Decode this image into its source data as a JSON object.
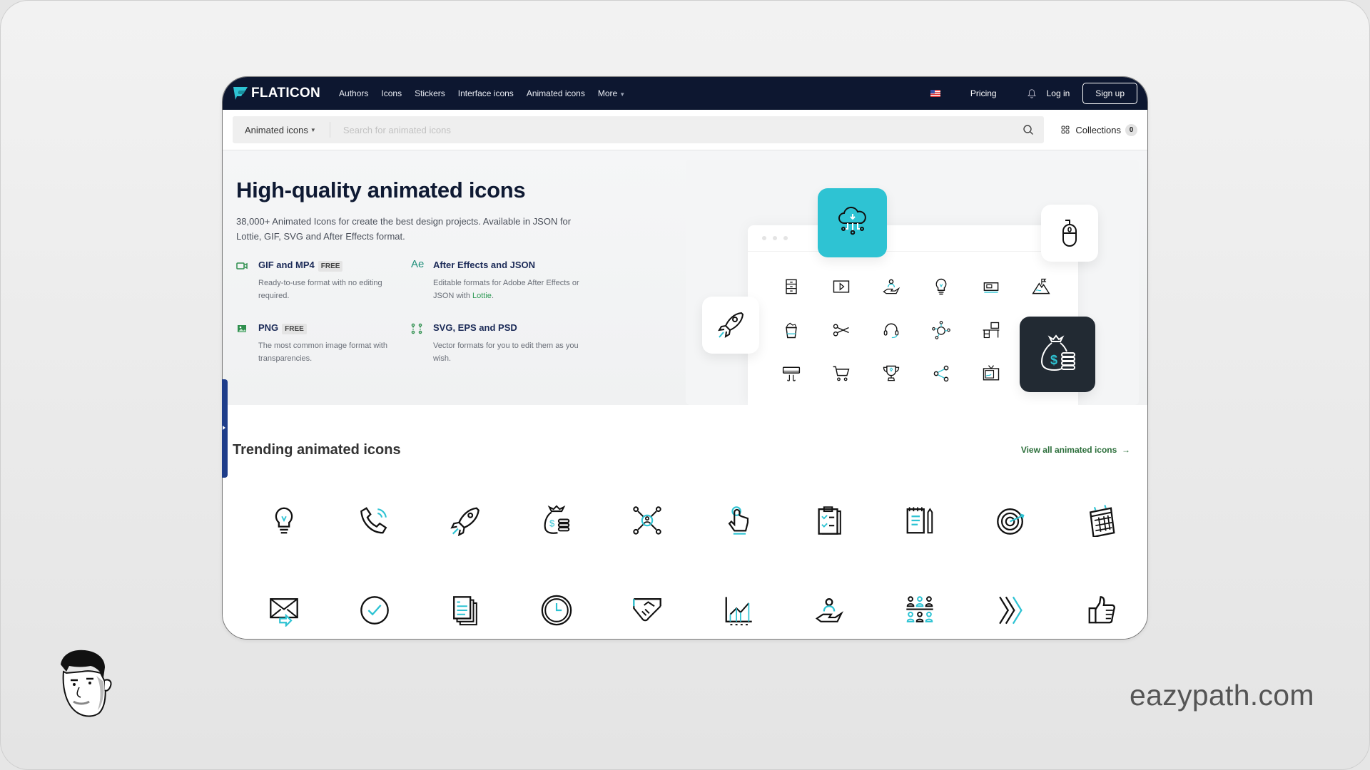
{
  "nav": {
    "logo": "FLATICON",
    "links": [
      "Authors",
      "Icons",
      "Stickers",
      "Interface icons",
      "Animated icons",
      "More"
    ],
    "flag_icon": "us-flag-icon",
    "pricing": "Pricing",
    "login": "Log in",
    "signup": "Sign up"
  },
  "search": {
    "category": "Animated icons",
    "placeholder": "Search for animated icons",
    "value": "",
    "collections_label": "Collections",
    "collections_count": "0"
  },
  "hero": {
    "title": "High-quality animated icons",
    "subtitle": "38,000+ Animated Icons for create the best design projects. Available in JSON for Lottie, GIF, SVG and After Effects format.",
    "features": [
      {
        "icon": "video-icon",
        "title": "GIF and MP4",
        "badge": "FREE",
        "desc": "Ready-to-use format with no editing required."
      },
      {
        "icon": "after-effects-icon",
        "icon_text": "Ae",
        "title": "After Effects and JSON",
        "badge": "",
        "desc_pre": "Editable formats for Adobe After Effects or JSON with ",
        "desc_link": "Lottie",
        "desc_post": "."
      },
      {
        "icon": "image-icon",
        "title": "PNG",
        "badge": "FREE",
        "desc": "The most common image format with transparencies."
      },
      {
        "icon": "vector-nodes-icon",
        "title": "SVG, EPS and PSD",
        "badge": "",
        "desc": "Vector formats for you to edit them as you wish."
      }
    ],
    "illustration_icons": [
      "cabinet",
      "video-player",
      "hand-user",
      "lightbulb",
      "cash-register",
      "mountain-flag",
      "trash-bin",
      "scissors",
      "headset",
      "network-user",
      "desk",
      "",
      "air-conditioner",
      "shopping-cart",
      "trophy",
      "share",
      "television",
      ""
    ],
    "floating_cards": [
      "cloud-network-icon",
      "mouse-icon",
      "rocket-icon",
      "money-bag-icon"
    ]
  },
  "trending": {
    "title": "Trending animated icons",
    "view_all": "View all animated icons",
    "row1": [
      "lightbulb",
      "phone-call",
      "rocket",
      "money-bag",
      "network",
      "tap-hand",
      "clipboard",
      "notepad-pencil",
      "target",
      "calendar"
    ],
    "row2": [
      "mail-forward",
      "check-circle",
      "documents",
      "clock",
      "handshake",
      "line-chart",
      "hand-user",
      "team",
      "chevrons-right",
      "thumbs-up"
    ]
  },
  "watermark": {
    "brand": "eazypath.com"
  },
  "colors": {
    "nav_bg": "#0d1730",
    "accent_cyan": "#2ec3d3",
    "green_link": "#2b6e3a",
    "dark_card": "#222a33"
  }
}
